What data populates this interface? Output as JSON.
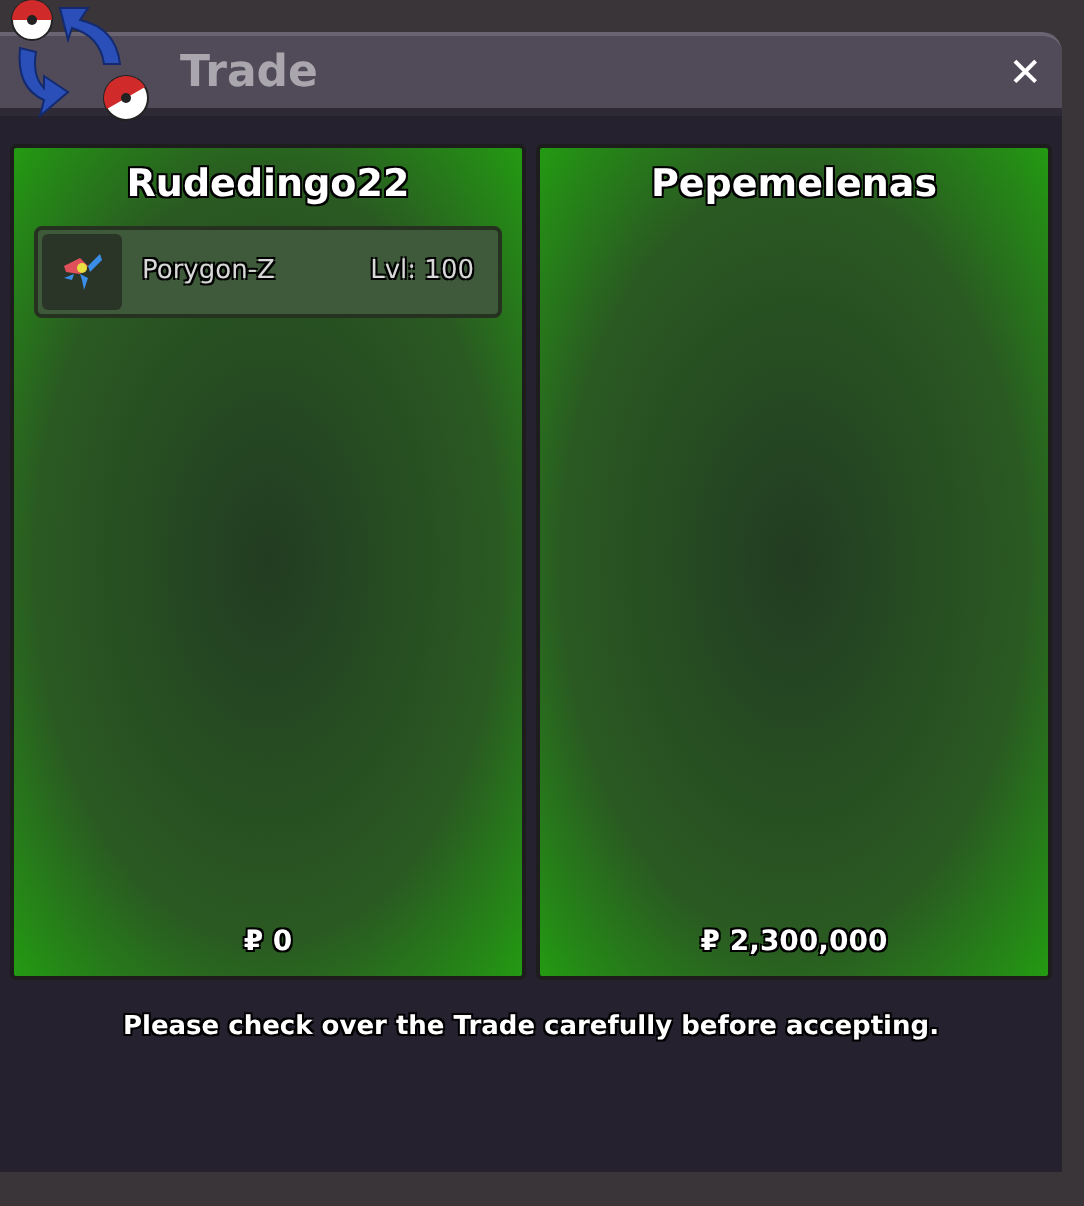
{
  "window": {
    "title": "Trade",
    "close": "✕"
  },
  "panels": [
    {
      "owner": "Rudedingo22",
      "items": [
        {
          "name": "Porygon-Z",
          "level": "Lvl: 100"
        }
      ],
      "money": "₽ 0"
    },
    {
      "owner": "Pepemelenas",
      "money": "₽ 2,300,000"
    }
  ],
  "message": "Please check over the Trade carefully before accepting."
}
